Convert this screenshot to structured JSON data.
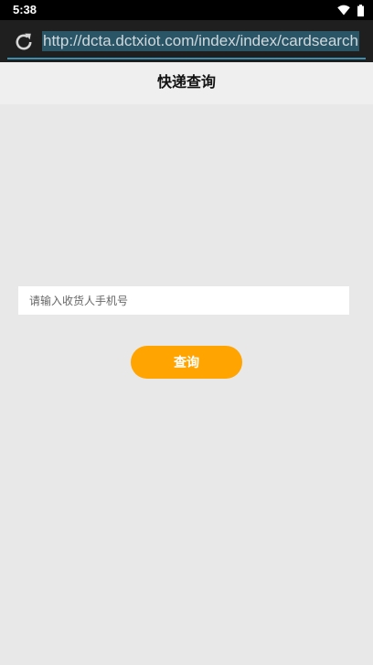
{
  "status_bar": {
    "time": "5:38",
    "icons": [
      "wifi-icon",
      "battery-icon"
    ]
  },
  "browser": {
    "url": "http://dcta.dctxiot.com/index/index/cardsearch",
    "icons": [
      "reload-icon"
    ]
  },
  "header": {
    "title": "快递查询"
  },
  "form": {
    "phone_placeholder": "请输入收货人手机号",
    "phone_value": "",
    "query_label": "查询"
  },
  "colors": {
    "accent": "#ffa400",
    "page_background": "#e8e8e8",
    "header_background": "#efefef"
  }
}
